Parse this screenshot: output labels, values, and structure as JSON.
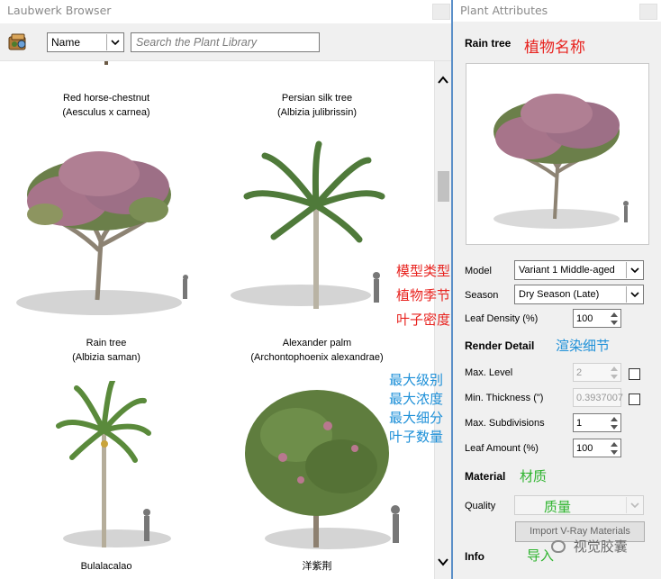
{
  "browser": {
    "title": "Laubwerk Browser",
    "sort_value": "Name",
    "search_placeholder": "Search the Plant Library",
    "plants": [
      {
        "name": "Red horse-chestnut",
        "latin": "(Aesculus x carnea)"
      },
      {
        "name": "Persian silk tree",
        "latin": "(Albizia julibrissin)"
      },
      {
        "name": "Rain tree",
        "latin": "(Albizia saman)"
      },
      {
        "name": "Alexander palm",
        "latin": "(Archontophoenix alexandrae)"
      },
      {
        "name": "Bulalacalao",
        "latin": ""
      },
      {
        "name": "洋紫荆",
        "latin": ""
      }
    ],
    "annotations": {
      "model_type": "模型类型",
      "plant_season": "植物季节",
      "leaf_density": "叶子密度",
      "max_level": "最大级别",
      "max_thickness": "最大浓度",
      "max_subdivision": "最大细分",
      "leaf_count": "叶子数量"
    }
  },
  "attributes": {
    "title": "Plant Attributes",
    "plant_name": "Rain tree",
    "plant_name_annotation": "植物名称",
    "model_label": "Model",
    "model_value": "Variant 1 Middle-aged",
    "season_label": "Season",
    "season_value": "Dry Season (Late)",
    "leaf_density_label": "Leaf Density (%)",
    "leaf_density_value": "100",
    "render_detail_title": "Render Detail",
    "render_detail_annotation": "渲染细节",
    "max_level_label": "Max. Level",
    "max_level_value": "2",
    "min_thickness_label": "Min. Thickness (\")",
    "min_thickness_value": "0.3937007",
    "max_subdivisions_label": "Max. Subdivisions",
    "max_subdivisions_value": "1",
    "leaf_amount_label": "Leaf Amount (%)",
    "leaf_amount_value": "100",
    "material_title": "Material",
    "material_annotation": "材质",
    "quality_label": "Quality",
    "quality_annotation": "质量",
    "import_button": "Import V-Ray Materials",
    "import_annotation": "导入",
    "info_title": "Info"
  },
  "watermark": "视觉胶囊",
  "colors": {
    "annotation_red": "#e8231f",
    "annotation_blue": "#1e90d8",
    "annotation_green": "#2fb42f",
    "foliage_pink": "#b9788f",
    "foliage_green": "#5f7d3e"
  }
}
